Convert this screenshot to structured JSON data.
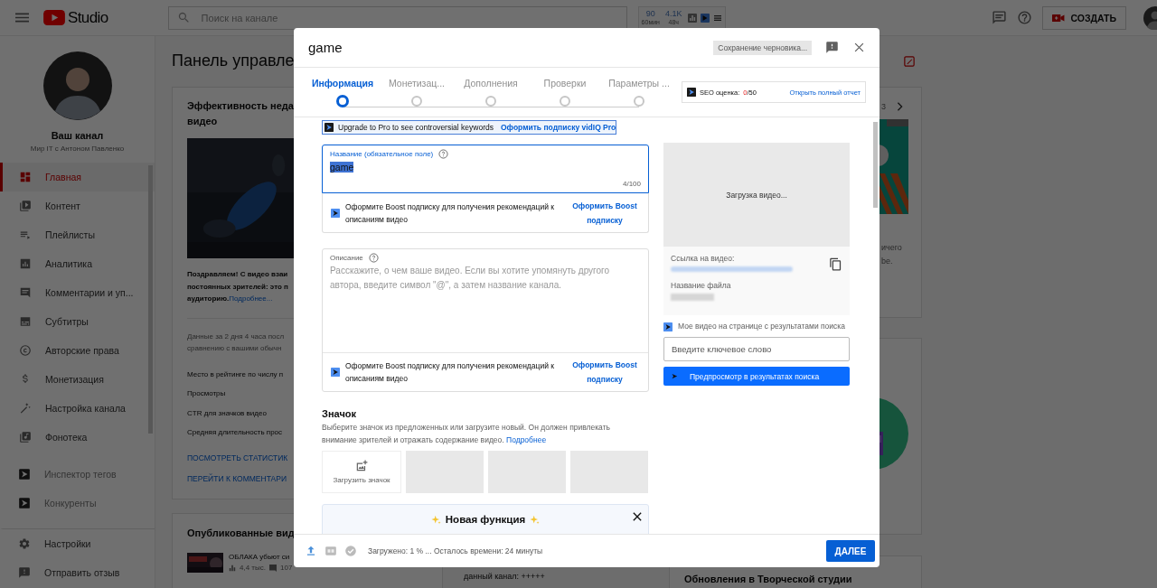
{
  "topbar": {
    "logo": "Studio",
    "search": {
      "placeholder": "Поиск на канале"
    },
    "vidiq_stats": [
      {
        "value": "90",
        "unit": "60мин"
      },
      {
        "value": "4.1K",
        "unit": "48ч"
      }
    ],
    "create_button": "СОЗДАТЬ"
  },
  "sidebar": {
    "channel_title": "Ваш канал",
    "channel_name": "Мир IT с Антоном Павленко",
    "items": [
      {
        "label": "Главная",
        "selected": true,
        "kind": "main"
      },
      {
        "label": "Контент",
        "selected": false,
        "kind": "main"
      },
      {
        "label": "Плейлисты",
        "selected": false,
        "kind": "main"
      },
      {
        "label": "Аналитика",
        "selected": false,
        "kind": "main"
      },
      {
        "label": "Комментарии и уп...",
        "selected": false,
        "kind": "main"
      },
      {
        "label": "Субтитры",
        "selected": false,
        "kind": "main"
      },
      {
        "label": "Авторские права",
        "selected": false,
        "kind": "main"
      },
      {
        "label": "Монетизация",
        "selected": false,
        "kind": "main"
      },
      {
        "label": "Настройка канала",
        "selected": false,
        "kind": "main"
      },
      {
        "label": "Фонотека",
        "selected": false,
        "kind": "main"
      },
      {
        "label": "Инспектор тегов",
        "selected": false,
        "kind": "vidiq"
      },
      {
        "label": "Конкуренты",
        "selected": false,
        "kind": "vidiq"
      },
      {
        "label": "Настройки",
        "selected": false,
        "kind": "footer"
      },
      {
        "label": "Отправить отзыв",
        "selected": false,
        "kind": "footer"
      }
    ]
  },
  "dashboard": {
    "title": "Панель управле",
    "performance_card": {
      "title_lines": [
        "Эффективность неда",
        "видео"
      ],
      "message_lines": [
        "Поздравляем! С видео взаи",
        "постоянных зрителей: это п",
        "аудиторию."
      ],
      "message_link": "Подробнее...",
      "period_lines": [
        "Данные за 2 дня 4 часа посл",
        "сравнению с вашими обычн"
      ],
      "metrics": [
        "Место в рейтинге по числу п",
        "Просмотры",
        "CTR для значков видео",
        "Средняя длительность прос"
      ],
      "links": [
        "ПОСМОТРЕТЬ СТАТИСТИК",
        "ПЕРЕЙТИ К КОММЕНТАРИ"
      ]
    },
    "published_card": {
      "title": "Опубликованные вид",
      "video": {
        "title": "ОБЛАКА убьют си",
        "views": "4,4 тыс.",
        "comments": "107"
      }
    },
    "news_card": {
      "page": "3",
      "text_lines": [
        "ичего",
        "be."
      ]
    },
    "bottom_text": "данный канал: +++++",
    "updates_card": {
      "title": "Обновления в Творческой студии"
    }
  },
  "dialog": {
    "title": "game",
    "save_status": "Сохранение черновика...",
    "steps": [
      {
        "label": "Информация",
        "selected": true
      },
      {
        "label": "Монетизац...",
        "selected": false
      },
      {
        "label": "Дополнения",
        "selected": false
      },
      {
        "label": "Проверки",
        "selected": false
      },
      {
        "label": "Параметры ...",
        "selected": false
      }
    ],
    "seo": {
      "label": "SEO оценка:",
      "score": "0",
      "max": "/50",
      "link": "Открыть полный отчет"
    },
    "upgrade_banner": {
      "text": "Upgrade to Pro to see controversial keywords",
      "link": "Оформить подписку vidIQ Pro"
    },
    "title_field": {
      "label": "Название (обязательное поле)",
      "value": "game",
      "value_selected": true,
      "counter": "4/100"
    },
    "title_boost": {
      "text": "Оформите Boost подписку для получения рекомендаций к описаниям видео",
      "link": "Оформить Boost подписку"
    },
    "description_field": {
      "label": "Описание",
      "placeholder": "Расскажите, о чем ваше видео. Если вы хотите упомянуть другого автора, введите символ \"@\", а затем название канала."
    },
    "description_boost": {
      "text": "Оформите Boost подписку для получения рекомендаций к описаниям видео",
      "link": "Оформить Boost подписку"
    },
    "thumbnail_section": {
      "title": "Значок",
      "text": "Выберите значок из предложенных или загрузите новый. Он должен привлекать внимание зрителей и отражать содержание видео.",
      "link": "Подробнее",
      "slots": [
        {
          "kind": "upload",
          "label": "Загрузить значок"
        },
        {
          "kind": "empty"
        },
        {
          "kind": "empty"
        },
        {
          "kind": "empty"
        }
      ]
    },
    "new_feature": {
      "title": "Новая функция"
    },
    "preview": {
      "status": "Загрузка видео...",
      "link_label": "Ссылка на видео:",
      "file_label": "Название файла"
    },
    "search_preview": {
      "text": "Мое видео на странице с результатами поиска",
      "placeholder": "Введите ключевое слово",
      "button": "Предпросмотр в результатах поиска"
    },
    "footer": {
      "status": "Загружено: 1 % ... Осталось времени: 24 минуты",
      "next_button": "ДАЛЕЕ"
    }
  }
}
